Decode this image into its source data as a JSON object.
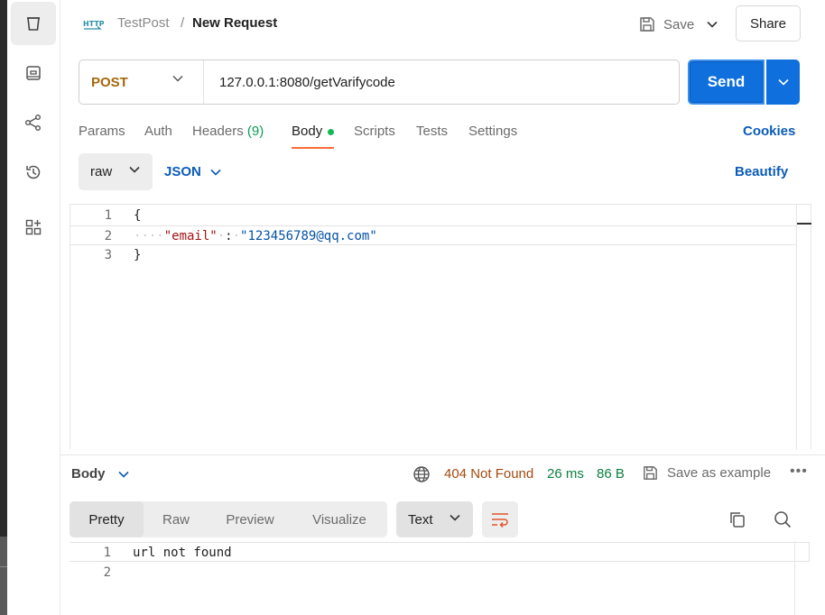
{
  "header": {
    "collection": "TestPost",
    "separator": "/",
    "request_name": "New Request",
    "save_label": "Save",
    "share_label": "Share",
    "http_icon_text": "HTTP"
  },
  "request": {
    "method": "POST",
    "url": "127.0.0.1:8080/getVarifycode",
    "send_label": "Send"
  },
  "tabs": {
    "params": "Params",
    "auth": "Auth",
    "headers": "Headers",
    "headers_count": "(9)",
    "body": "Body",
    "scripts": "Scripts",
    "tests": "Tests",
    "settings": "Settings",
    "cookies": "Cookies"
  },
  "body_toolbar": {
    "mode": "raw",
    "language": "JSON",
    "beautify": "Beautify"
  },
  "editor": {
    "lines": [
      {
        "num": "1",
        "open": "{"
      },
      {
        "num": "2",
        "indent": "····",
        "key": "\"email\"",
        "sep1": "·",
        "colon": ":",
        "sep2": "·",
        "value": "\"123456789@qq.com\""
      },
      {
        "num": "3",
        "close": "}"
      }
    ]
  },
  "response": {
    "section_label": "Body",
    "status": "404 Not Found",
    "time": "26 ms",
    "size": "86 B",
    "save_example": "Save as example",
    "more": "•••",
    "views": [
      "Pretty",
      "Raw",
      "Preview",
      "Visualize"
    ],
    "format": "Text",
    "lines": [
      {
        "num": "1",
        "text": "url not found"
      },
      {
        "num": "2",
        "text": ""
      }
    ]
  },
  "colors": {
    "send": "#0e6fdd",
    "method": "#a4680b",
    "link": "#0b5bb8",
    "active_tab_underline": "#ff6c37",
    "status_error": "#a14a10",
    "status_ok": "#0a7f3f"
  }
}
